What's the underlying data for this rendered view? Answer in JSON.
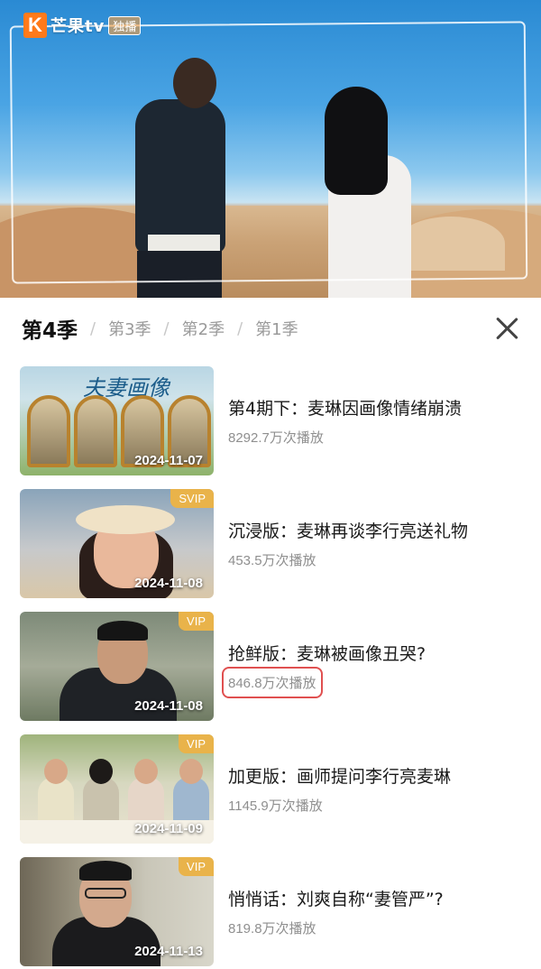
{
  "hero": {
    "brand_name": "芒果tv",
    "brand_tag": "独播"
  },
  "season_bar": {
    "tabs": [
      {
        "label": "第4季",
        "active": true
      },
      {
        "label": "第3季",
        "active": false
      },
      {
        "label": "第2季",
        "active": false
      },
      {
        "label": "第1季",
        "active": false
      }
    ],
    "separator": "/",
    "close_icon": "close-icon"
  },
  "episodes": [
    {
      "title": "第4期下：麦琳因画像情绪崩溃",
      "views": "8292.7万次播放",
      "date": "2024-11-07",
      "badge": "",
      "thumb_text": "夫妻画像"
    },
    {
      "title": "沉浸版：麦琳再谈李行亮送礼物",
      "views": "453.5万次播放",
      "date": "2024-11-08",
      "badge": "SVIP"
    },
    {
      "title": "抢鲜版：麦琳被画像丑哭?",
      "views": "846.8万次播放",
      "date": "2024-11-08",
      "badge": "VIP"
    },
    {
      "title": "加更版：画师提问李行亮麦琳",
      "views": "1145.9万次播放",
      "date": "2024-11-09",
      "badge": "VIP"
    },
    {
      "title": "悄悄话：刘爽自称“妻管严”?",
      "views": "819.8万次播放",
      "date": "2024-11-13",
      "badge": "VIP"
    }
  ],
  "colors": {
    "badge": "#e9b34a",
    "highlight_box": "#e05050",
    "brand_orange": "#ff7a1a"
  }
}
